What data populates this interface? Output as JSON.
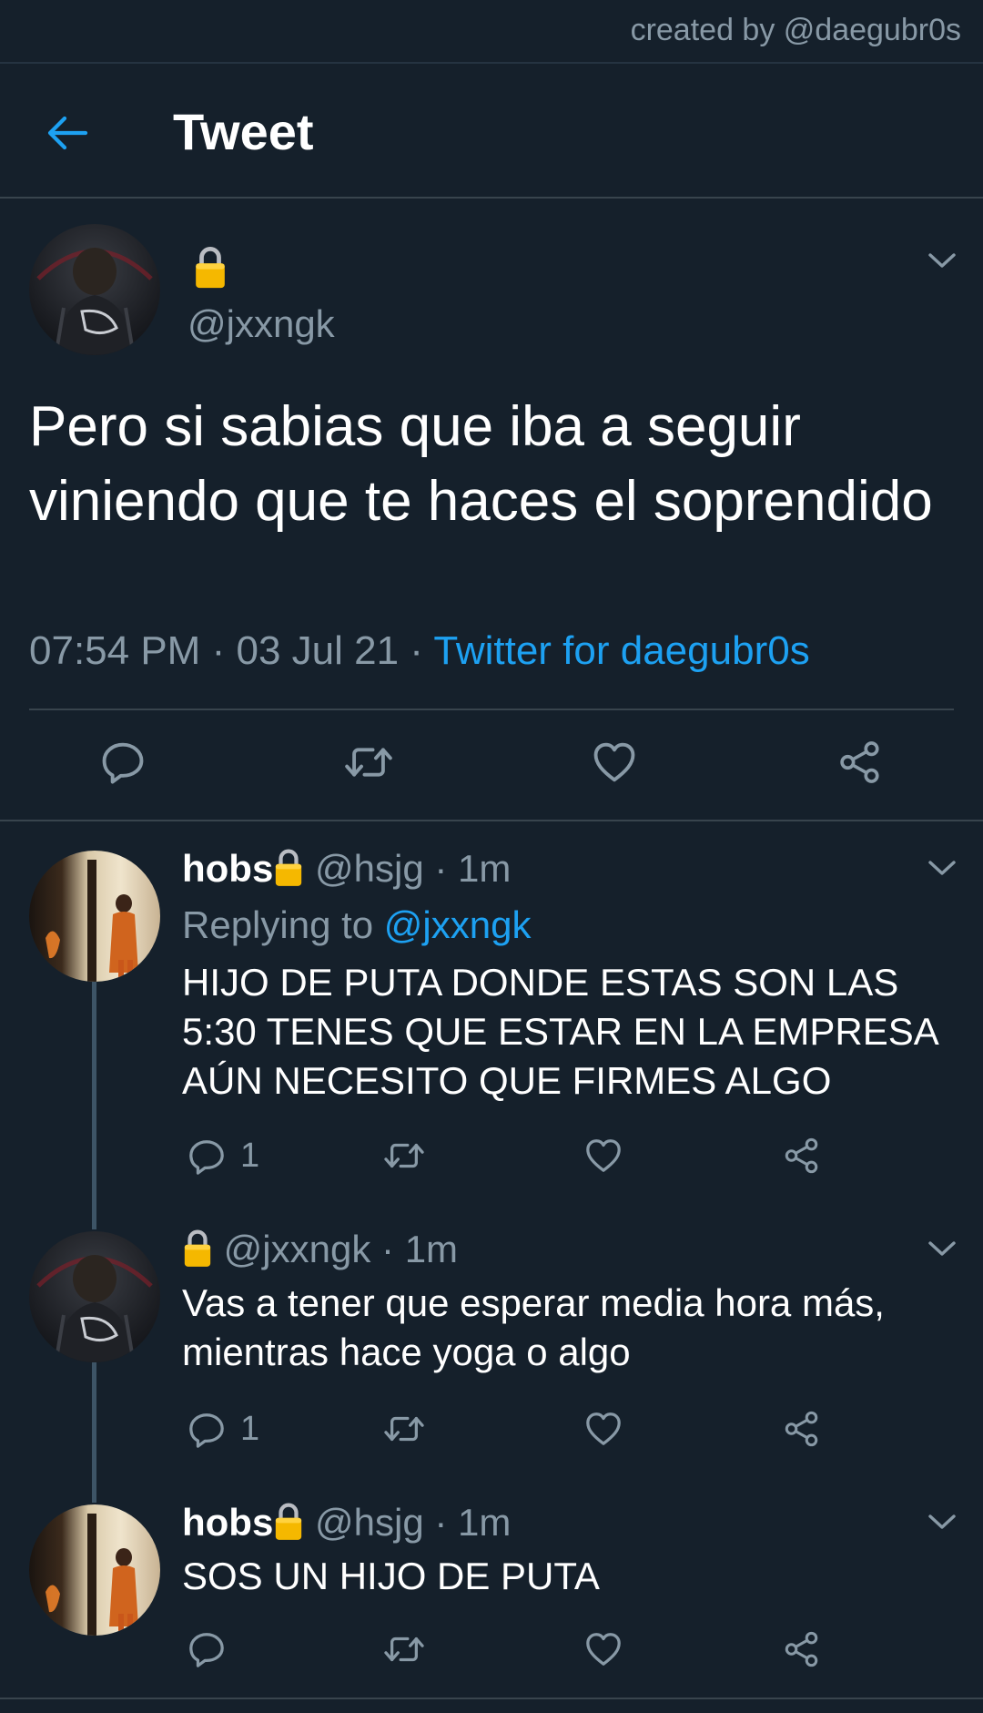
{
  "credit": "created by @daegubr0s",
  "header": {
    "title": "Tweet"
  },
  "main_tweet": {
    "handle": "@jxxngk",
    "text": "Pero si sabias que iba a seguir viniendo que te haces el soprendido",
    "time": "07:54 PM",
    "sep1": "·",
    "date": "03 Jul 21",
    "sep2": "·",
    "source": "Twitter for daegubr0s"
  },
  "replies": [
    {
      "name": "hobs",
      "handle": "@hsjg",
      "sep": "·",
      "age": "1m",
      "replying_prefix": "Replying to",
      "replying_handle": "@jxxngk",
      "text": "HIJO DE PUTA DONDE ESTAS SON LAS 5:30 TENES QUE ESTAR EN LA EMPRESA AÚN NECESITO QUE FIRMES ALGO",
      "reply_count": "1"
    },
    {
      "handle": "@jxxngk",
      "sep": "·",
      "age": "1m",
      "text": "Vas a tener que esperar media hora más, mientras hace yoga o algo",
      "reply_count": "1"
    },
    {
      "name": "hobs",
      "handle": "@hsjg",
      "sep": "·",
      "age": "1m",
      "text": "SOS UN HIJO DE PUTA"
    }
  ],
  "colors": {
    "background": "#15202b",
    "accent": "#1da1f2",
    "muted": "#8899a6",
    "divider": "#38444d",
    "lock": "#f5b800"
  },
  "icons": [
    "back-arrow-icon",
    "lock-icon",
    "chevron-down-icon",
    "reply-icon",
    "retweet-icon",
    "like-icon",
    "share-icon"
  ]
}
